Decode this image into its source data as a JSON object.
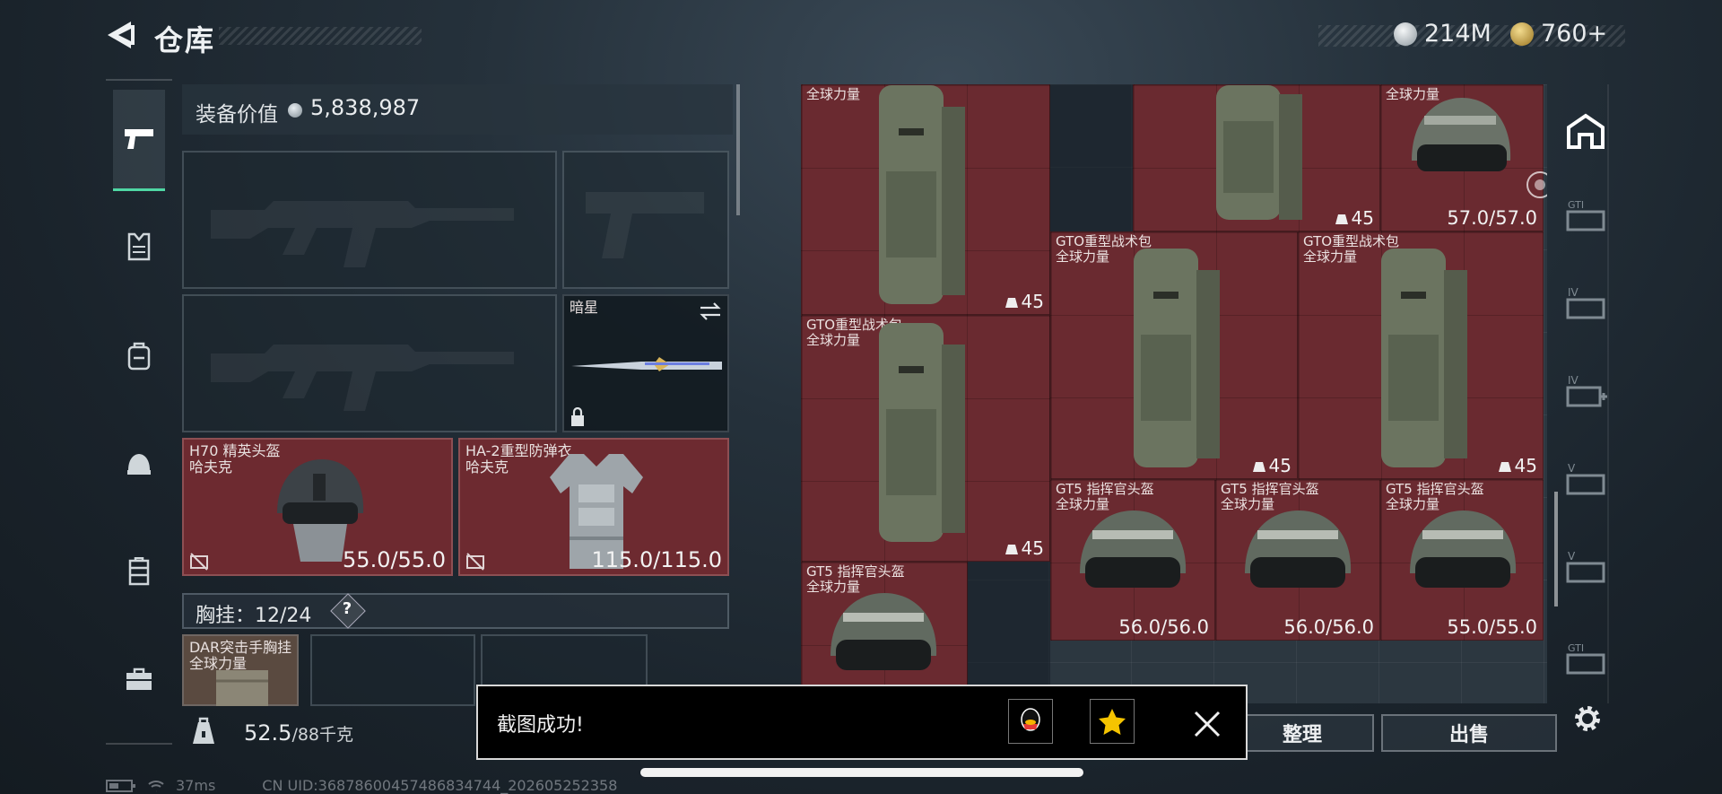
{
  "header": {
    "title": "仓库",
    "currency_1": "214M",
    "currency_2": "760+",
    "colors": {
      "accent_green": "#4fd7a4",
      "item_red": "#6a2a30",
      "coin_gold": "#c8a24a"
    }
  },
  "left_nav": {
    "items": [
      {
        "name": "weapons",
        "icon": "pistol-icon",
        "selected": true
      },
      {
        "name": "armor",
        "icon": "vest-icon"
      },
      {
        "name": "backpack",
        "icon": "backpack-icon"
      },
      {
        "name": "helmet",
        "icon": "helmet-icon"
      },
      {
        "name": "rig",
        "icon": "rig-icon"
      },
      {
        "name": "case",
        "icon": "briefcase-icon"
      }
    ]
  },
  "loadout": {
    "value_label": "装备价值",
    "value": "5,838,987",
    "melee": {
      "name": "暗星"
    },
    "helmet": {
      "name": "H70 精英头盔",
      "brand": "哈夫克",
      "durability": "55.0/55.0"
    },
    "armor": {
      "name": "HA-2重型防弹衣",
      "brand": "哈夫克",
      "durability": "115.0/115.0"
    },
    "chest_rig": {
      "label": "胸挂：",
      "capacity": "12/24",
      "help": "?",
      "item_name": "DAR突击手胸挂",
      "item_sub": "全球力量"
    },
    "weight": {
      "current": "52.5",
      "max": "/88千克"
    }
  },
  "stash_items": [
    {
      "name": "",
      "sub": "全球力量",
      "count": "45"
    },
    {
      "name": "",
      "sub": "",
      "count": "45"
    },
    {
      "name": "",
      "sub": "全球力量",
      "durability": "57.0/57.0"
    },
    {
      "name": "GTO重型战术包",
      "sub": "全球力量",
      "count": "45"
    },
    {
      "name": "GTO重型战术包",
      "sub": "全球力量",
      "count": "45"
    },
    {
      "name": "GTO重型战术包",
      "sub": "全球力量",
      "count": "45"
    },
    {
      "name": "GT5 指挥官头盔",
      "sub": "全球力量",
      "durability": "56.0/56.0"
    },
    {
      "name": "GT5 指挥官头盔",
      "sub": "全球力量",
      "durability": "56.0/56.0"
    },
    {
      "name": "GT5 指挥官头盔",
      "sub": "全球力量",
      "durability": "55.0/55.0"
    },
    {
      "name": "GT5 指挥官头盔",
      "sub": "全球力量"
    }
  ],
  "right_tabs": [
    {
      "icon": "home-icon",
      "label": ""
    },
    {
      "icon": "case-gti-icon",
      "label": "GTI"
    },
    {
      "icon": "case-iv-icon",
      "label": "IV"
    },
    {
      "icon": "case-iv-add-icon",
      "label": "IV"
    },
    {
      "icon": "case-v-icon",
      "label": "V"
    },
    {
      "icon": "case-v2-icon",
      "label": "V"
    },
    {
      "icon": "case-gti2-icon",
      "label": "GTI"
    }
  ],
  "actions": {
    "sort": "整理",
    "sell": "出售"
  },
  "toast": {
    "message": "截图成功!"
  },
  "status": {
    "ping": "37ms",
    "uid": "CN UID:3687860045748683474​4_202605252358"
  }
}
